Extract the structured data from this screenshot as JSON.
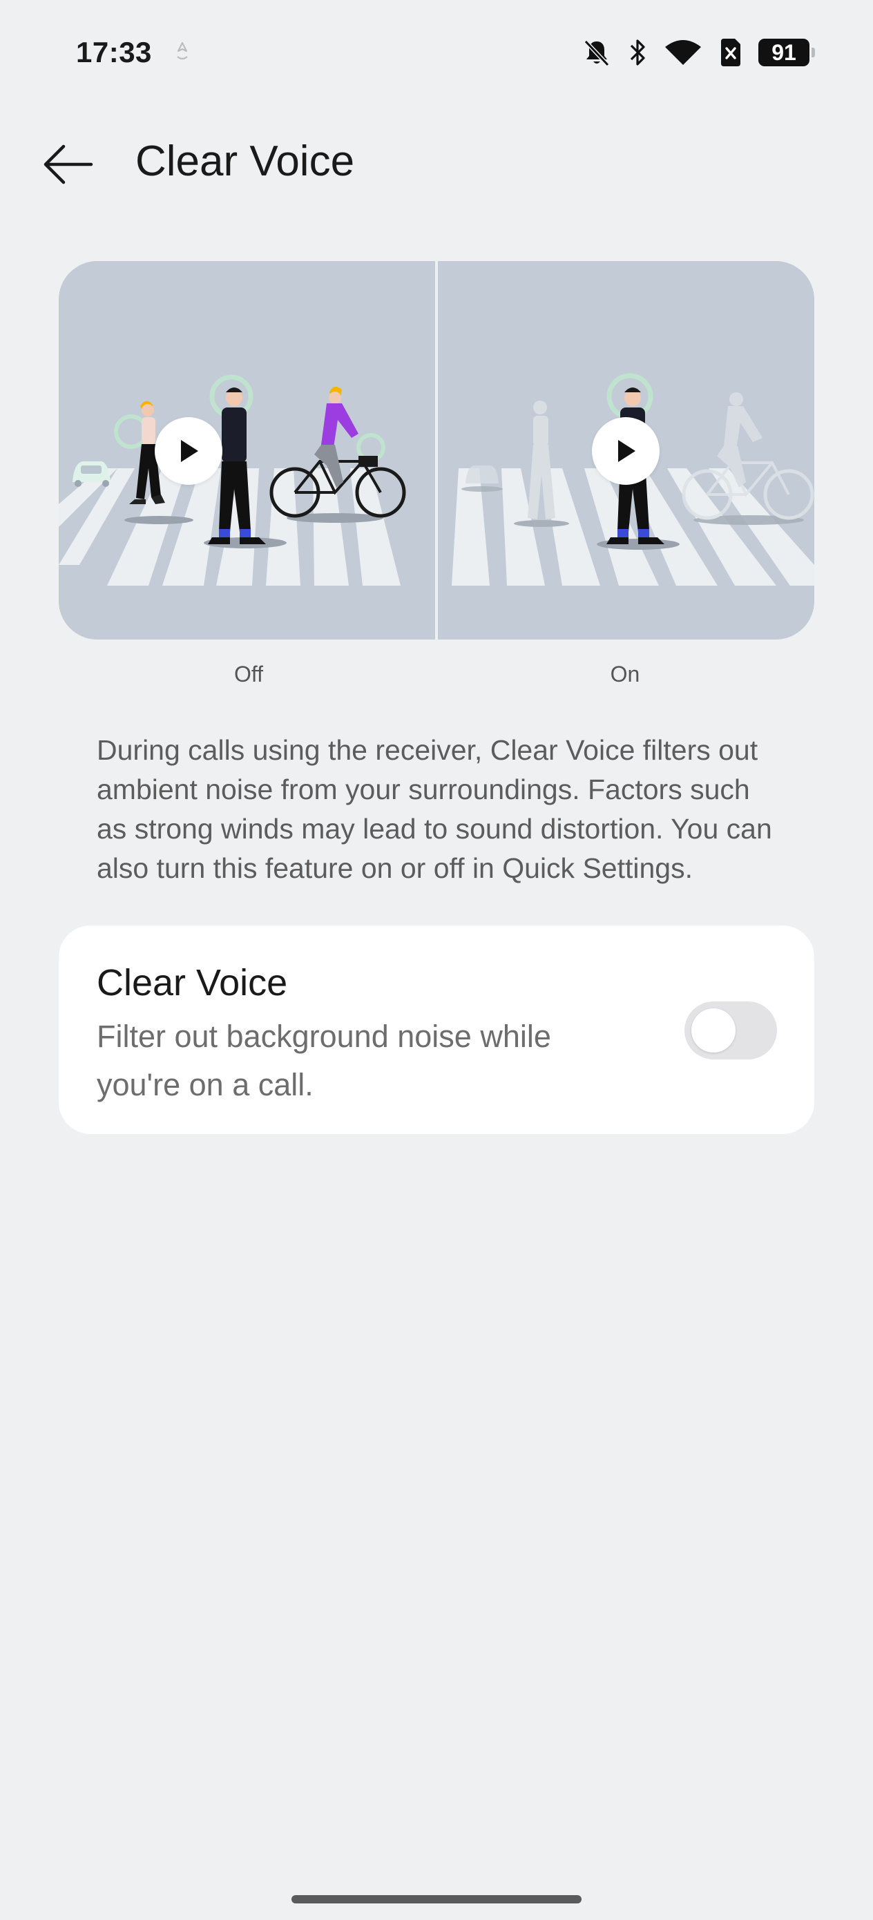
{
  "status_bar": {
    "time": "17:33",
    "battery_level": "91",
    "icons": [
      "location-icon",
      "silent-icon",
      "bluetooth-icon",
      "wifi-icon",
      "no-sim-icon",
      "battery-icon"
    ]
  },
  "header": {
    "title": "Clear Voice",
    "back_icon": "arrow-left-icon"
  },
  "illustration": {
    "off_caption": "Off",
    "on_caption": "On",
    "play_icon": "play-icon"
  },
  "description": "During calls using the receiver, Clear Voice filters out ambient noise from your surroundings. Factors such as strong winds may lead to sound distortion. You can also turn this feature on or off in Quick Settings.",
  "setting": {
    "title": "Clear Voice",
    "subtitle": "Filter out background noise while you're on a call.",
    "enabled": false
  },
  "colors": {
    "background": "#eff0f2",
    "card": "#ffffff",
    "illustration_bg": "#c3ccd6",
    "toggle_off": "#e3e3e5",
    "accent_purple": "#9b3de0",
    "accent_yellow": "#f5b400",
    "accent_blue": "#3a4bd8"
  }
}
